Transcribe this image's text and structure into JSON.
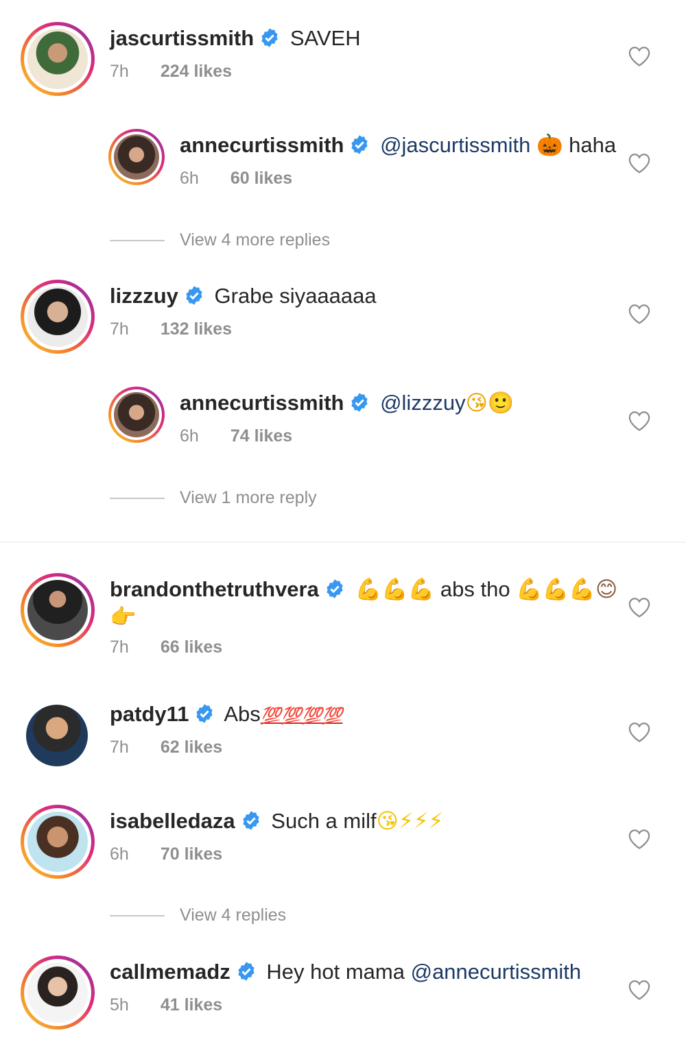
{
  "comments": [
    {
      "username": "jascurtissmith",
      "text": "SAVEH",
      "time": "7h",
      "likes": "224 likes"
    },
    {
      "username": "annecurtissmith",
      "mention": "@jascurtissmith",
      "emoji": "🎃",
      "text": "haha",
      "time": "6h",
      "likes": "60 likes"
    },
    {
      "view_more": "View 4 more replies"
    },
    {
      "username": "lizzzuy",
      "text": "Grabe siyaaaaaa",
      "time": "7h",
      "likes": "132 likes"
    },
    {
      "username": "annecurtissmith",
      "mention": "@lizzzuy",
      "emoji": "😘🙂",
      "time": "6h",
      "likes": "74 likes"
    },
    {
      "view_more": "View 1 more reply"
    },
    {
      "username": "brandonthetruthvera",
      "emoji_pre": "💪💪💪",
      "text": "abs tho",
      "emoji_post": "💪💪💪😊",
      "emoji_line2": "👉",
      "time": "7h",
      "likes": "66 likes"
    },
    {
      "username": "patdy11",
      "text": "Abs",
      "emoji": "💯💯💯💯",
      "time": "7h",
      "likes": "62 likes"
    },
    {
      "username": "isabelledaza",
      "text": "Such a milf",
      "emoji": "😘⚡⚡⚡",
      "time": "6h",
      "likes": "70 likes"
    },
    {
      "view_more": "View 4 replies"
    },
    {
      "username": "callmemadz",
      "text": "Hey hot mama",
      "mention": "@annecurtissmith",
      "time": "5h",
      "likes": "41 likes"
    }
  ],
  "icons": {
    "verified": "verified-badge-icon",
    "heart": "heart-outline-icon"
  },
  "colors": {
    "verified": "#3897f0",
    "meta_text": "#8e8e8e",
    "mention": "#1c3a66"
  }
}
